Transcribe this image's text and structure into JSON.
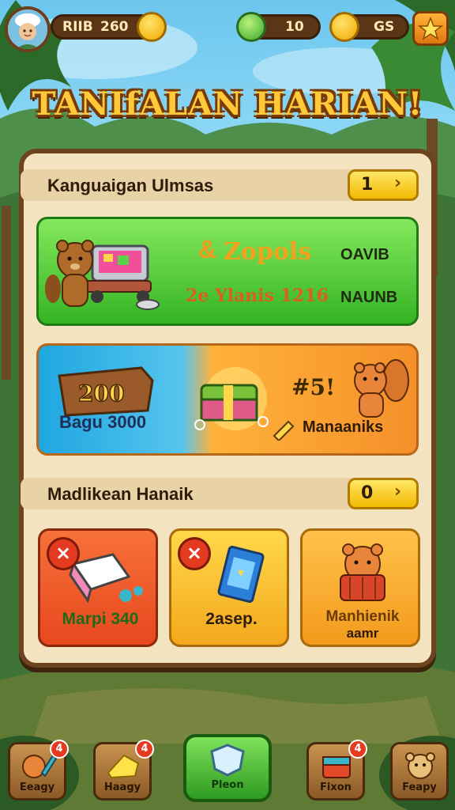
{
  "topbar": {
    "player_name": "RIIB",
    "coins": "260",
    "gems": "10",
    "gold": "GS"
  },
  "title": "TANIfALAN HARIAN!",
  "section1": {
    "label": "Kanguaigan Ulmsas",
    "count": "1",
    "chevron": "›"
  },
  "green_card": {
    "title": "Zopols",
    "subtitle": "2e Ylanis 1216",
    "right_top": "OAVIB",
    "right_bottom": "NAUNB"
  },
  "promo_card": {
    "left_label": "Bagu 3000",
    "sign_text": "200",
    "burst_text": "#5!",
    "right_label": "Manaaniks"
  },
  "section2": {
    "label": "Madlikean Hanaik",
    "count": "0",
    "chevron": "›"
  },
  "tiles": [
    {
      "label": "Marpi 340",
      "badge": "×"
    },
    {
      "label": "2asep.",
      "badge": "×"
    },
    {
      "label": "Manhienik",
      "label2": "aamr"
    }
  ],
  "nav": [
    {
      "label": "Eeagy",
      "badge": "4"
    },
    {
      "label": "Haagy",
      "badge": "4"
    },
    {
      "label": "Pleon"
    },
    {
      "label": "Fixon",
      "badge": "4"
    },
    {
      "label": "Feapy"
    }
  ],
  "colors": {
    "accent_green": "#3cba2a",
    "accent_orange": "#f39a1c",
    "accent_yellow": "#ffd31a",
    "panel_bg": "#f3e3c0",
    "frame_brown": "#6e4320"
  }
}
